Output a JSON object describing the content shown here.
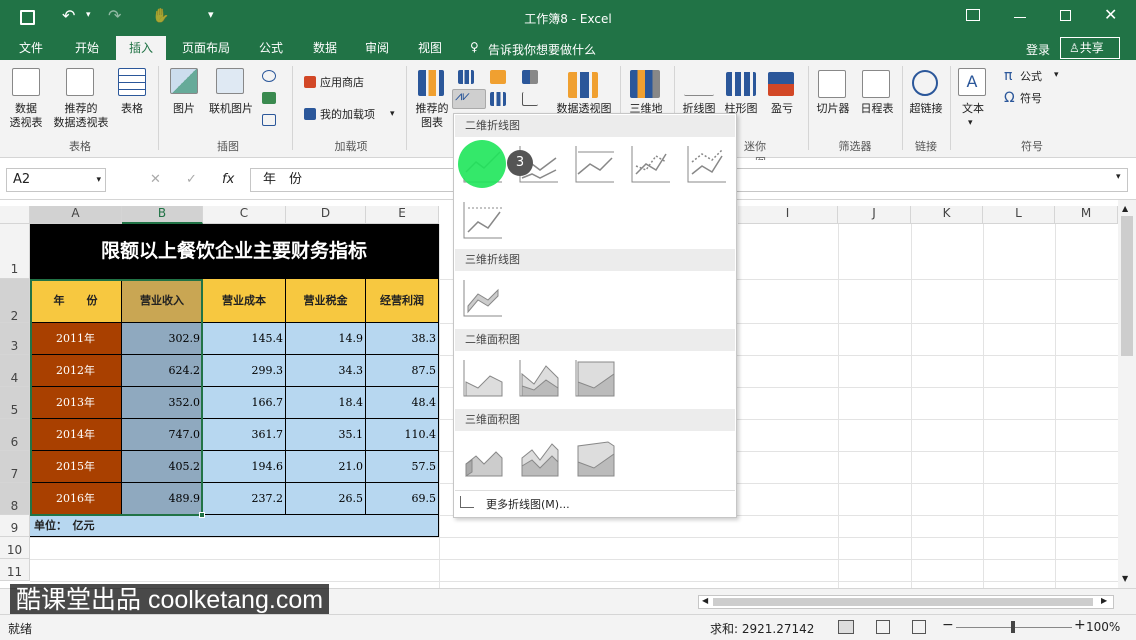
{
  "title": {
    "doc": "工作簿8 - Excel"
  },
  "tabs": [
    "文件",
    "开始",
    "插入",
    "页面布局",
    "公式",
    "数据",
    "审阅",
    "视图"
  ],
  "tell_me": "告诉我你想要做什么",
  "login": "登录",
  "share": "共享",
  "ribbon": {
    "pivot": "数据\n透视表",
    "rec_pivot": "推荐的\n数据透视表",
    "table": "表格",
    "grp_table": "表格",
    "pictures": "图片",
    "online_pictures": "联机图片",
    "grp_illus": "插图",
    "store": "应用商店",
    "my_addins": "我的加载项",
    "grp_addins": "加载项",
    "rec_charts": "推荐的\n图表",
    "pivot_chart": "数据透视图",
    "map3d": "三维地",
    "line": "折线图",
    "column": "柱形图",
    "winloss": "盈亏",
    "grp_spark": "迷你图",
    "slicer": "切片器",
    "timeline": "日程表",
    "grp_filter": "筛选器",
    "hyperlink": "超链接",
    "grp_link": "链接",
    "text": "文本",
    "formula": "公式",
    "symbol": "符号",
    "grp_symbol": "符号"
  },
  "namebox": "A2",
  "formula": "年　份",
  "columns": [
    "A",
    "B",
    "C",
    "D",
    "E",
    "I",
    "J",
    "K",
    "L",
    "M"
  ],
  "rows": [
    "1",
    "2",
    "3",
    "4",
    "5",
    "6",
    "7",
    "8",
    "9",
    "10",
    "11"
  ],
  "sheet": {
    "title": "限额以上餐饮企业主要财务指标",
    "headers": [
      "年　　份",
      "营业收入",
      "营业成本",
      "营业税金",
      "经营利润"
    ],
    "data": [
      [
        "2011年",
        "302.9",
        "145.4",
        "14.9",
        "38.3"
      ],
      [
        "2012年",
        "624.2",
        "299.3",
        "34.3",
        "87.5"
      ],
      [
        "2013年",
        "352.0",
        "166.7",
        "18.4",
        "48.4"
      ],
      [
        "2014年",
        "747.0",
        "361.7",
        "35.1",
        "110.4"
      ],
      [
        "2015年",
        "405.2",
        "194.6",
        "21.0",
        "57.5"
      ],
      [
        "2016年",
        "489.9",
        "237.2",
        "26.5",
        "69.5"
      ]
    ],
    "unit": "单位：　亿元"
  },
  "dropdown": {
    "sec1": "二维折线图",
    "sec2": "三维折线图",
    "sec3": "二维面积图",
    "sec4": "三维面积图",
    "more": "更多折线图(M)...",
    "badge": "3"
  },
  "status": {
    "ready": "就绪",
    "sum": "求和: 2921.27142",
    "zoom": "100%"
  },
  "watermark": "酷课堂出品 coolketang.com"
}
